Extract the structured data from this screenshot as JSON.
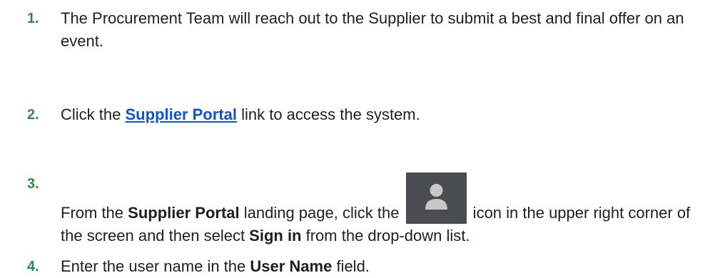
{
  "steps": [
    {
      "number": "1.",
      "text": "The Procurement Team will reach out to the Supplier to submit a best and final offer on an event."
    },
    {
      "number": "2.",
      "prefix": "Click the ",
      "link": "Supplier Portal",
      "suffix": " link to access the system."
    },
    {
      "number": "3.",
      "prefix": "From the ",
      "bold1": "Supplier Portal",
      "mid1": " landing page, click the ",
      "icon": "user-avatar-icon",
      "mid2": " icon in the upper right corner of the screen and then select ",
      "bold2": "Sign in",
      "suffix": " from the drop-down list."
    },
    {
      "number": "4.",
      "prefix": "Enter the user name in the ",
      "bold1": "User Name",
      "suffix": " field."
    }
  ],
  "colors": {
    "step_number": "#2f8a4a",
    "link": "#1155cc",
    "icon_background": "#4a4d50",
    "icon_glyph": "#c8c8c8"
  }
}
